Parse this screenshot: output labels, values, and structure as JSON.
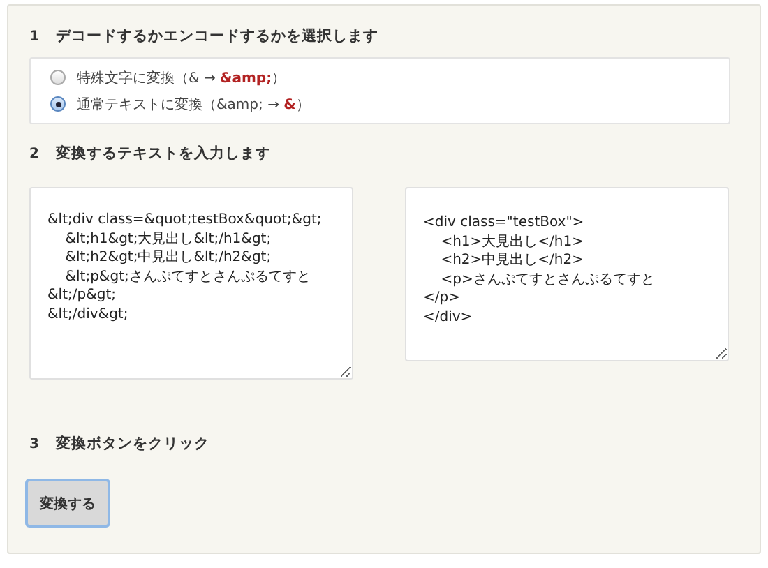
{
  "steps": [
    {
      "number": "1",
      "title": "デコードするかエンコードするかを選択します"
    },
    {
      "number": "2",
      "title": "変換するテキストを入力します"
    },
    {
      "number": "3",
      "title": "変換ボタンをクリック"
    }
  ],
  "options": [
    {
      "text_before": "特殊文字に変換（& → ",
      "highlight": "&amp;",
      "text_after": "）",
      "selected": false
    },
    {
      "text_before": "通常テキストに変換（&amp; → ",
      "highlight": "&",
      "text_after": "）",
      "selected": true
    }
  ],
  "input_text": "&lt;div class=&quot;testBox&quot;&gt;\n\t&lt;h1&gt;大見出し&lt;/h1&gt;\n\t&lt;h2&gt;中見出し&lt;/h2&gt;\n\t&lt;p&gt;さんぷてすとさんぷるてすと&lt;/p&gt;\n&lt;/div&gt;",
  "output_text": "<div class=\"testBox\">\n\t<h1>大見出し</h1>\n\t<h2>中見出し</h2>\n\t<p>さんぷてすとさんぷるてすと\n</p>\n</div>",
  "convert_button": "変換する"
}
